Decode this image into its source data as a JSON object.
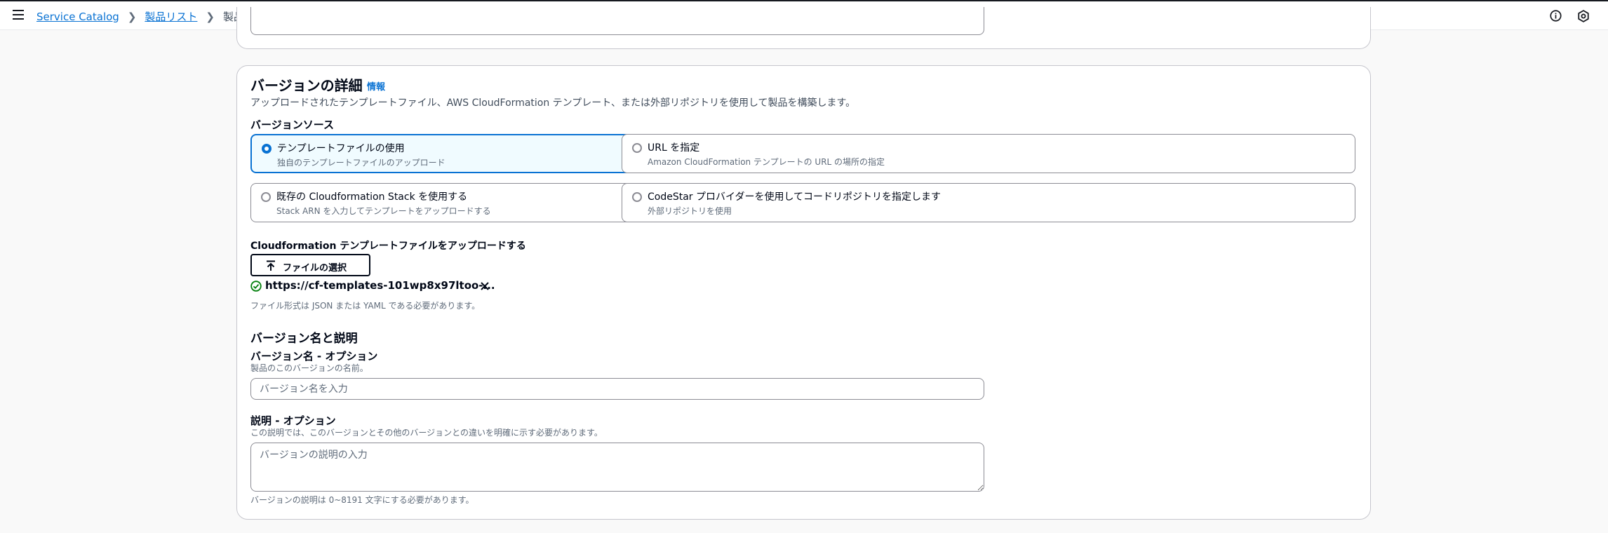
{
  "breadcrumb": {
    "items": [
      "Service Catalog",
      "製品リスト"
    ],
    "current": "製品を作成"
  },
  "version_details": {
    "title": "バージョンの詳細",
    "info_link": "情報",
    "description": "アップロードされたテンプレートファイル、AWS CloudFormation テンプレート、または外部リポジトリを使用して製品を構築します。",
    "source_label": "バージョンソース",
    "options": [
      {
        "title": "テンプレートファイルの使用",
        "subtitle": "独自のテンプレートファイルのアップロード",
        "selected": true
      },
      {
        "title": "URL を指定",
        "subtitle": "Amazon CloudFormation テンプレートの URL の場所の指定",
        "selected": false
      },
      {
        "title": "既存の Cloudformation Stack を使用する",
        "subtitle": "Stack ARN を入力してテンプレートをアップロードする",
        "selected": false
      },
      {
        "title": "CodeStar プロバイダーを使用してコードリポジトリを指定します",
        "subtitle": "外部リポジトリを使用",
        "selected": false
      }
    ],
    "upload_label": "Cloudformation テンプレートファイルをアップロードする",
    "choose_file_button": "ファイルの選択",
    "uploaded_file": "https://cf-templates-101wp8x97ltoo-...",
    "file_format_hint": "ファイル形式は JSON または YAML である必要があります。"
  },
  "version_name_section": {
    "title": "バージョン名と説明",
    "name_label": "バージョン名 - オプション",
    "name_description": "製品のこのバージョンの名前。",
    "name_placeholder": "バージョン名を入力",
    "desc_label": "説明 - オプション",
    "desc_description": "この説明では、このバージョンとその他のバージョンとの違いを明確に示す必要があります。",
    "desc_placeholder": "バージョンの説明の入力",
    "desc_constraint": "バージョンの説明は 0~8191 文字にする必要があります。"
  },
  "colors": {
    "accent": "#0972d3",
    "success": "#037f0c",
    "text": "#000716"
  }
}
